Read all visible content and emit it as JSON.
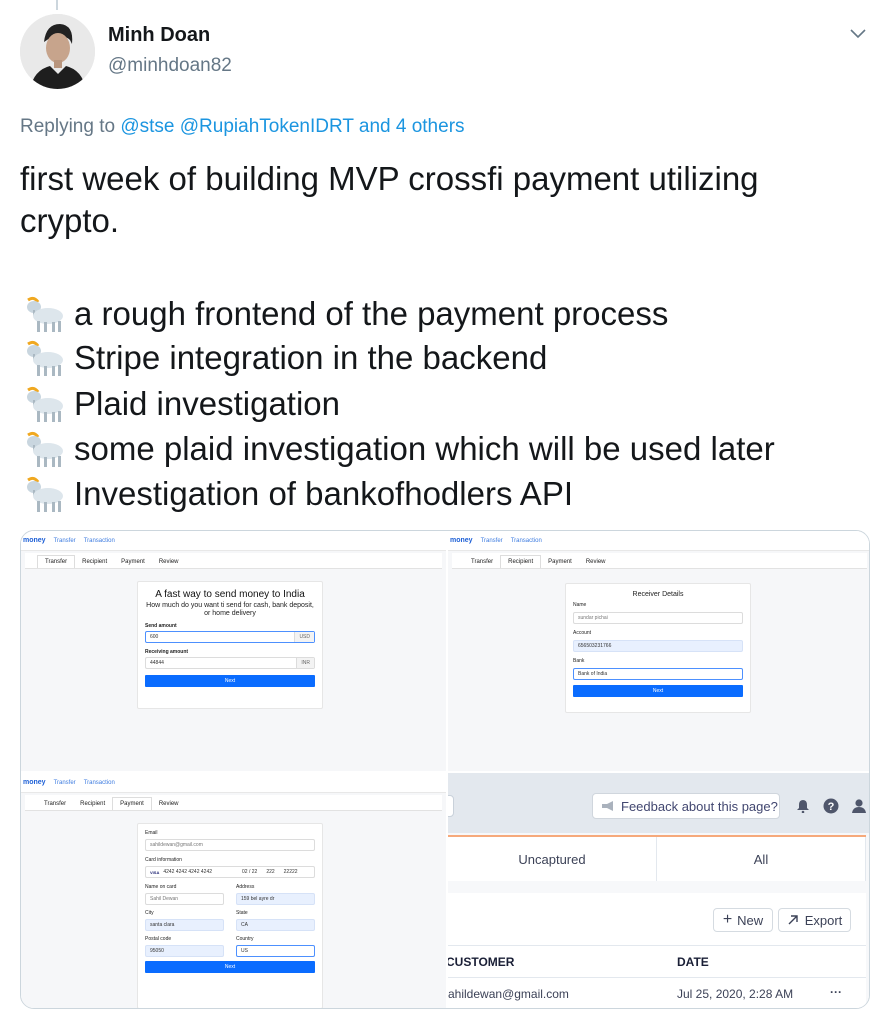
{
  "author": {
    "name": "Minh Doan",
    "handle": "@minhdoan82"
  },
  "reply": {
    "prefix": "Replying to",
    "mention1": "@stse",
    "mention2": "@RupiahTokenIDRT",
    "others": "and 4 others"
  },
  "tweet": {
    "text": "first week of building MVP crossfi payment utilizing crypto.",
    "bullets": [
      "a rough frontend of the payment process",
      "Stripe integration in the backend",
      "Plaid  investigation",
      "some plaid investigation which will be used later",
      "Investigation of bankofhodlers API"
    ]
  },
  "app": {
    "brand": "money",
    "nav_transfer": "Transfer",
    "nav_transaction": "Transaction",
    "tabs": [
      "Transfer",
      "Recipient",
      "Payment",
      "Review"
    ]
  },
  "transfer": {
    "title": "A fast way to send money to India",
    "subtitle": "How much do you want ti send for cash, bank deposit, or home delivery",
    "send_label": "Send amount",
    "send_value": "600",
    "send_currency": "USD",
    "receive_label": "Receiving amount",
    "receive_value": "44844",
    "receive_currency": "INR",
    "next": "Next"
  },
  "recipient": {
    "title": "Receiver Details",
    "name_label": "Name",
    "name_value": "sundar pichai",
    "account_label": "Account",
    "account_value": "656503231766",
    "bank_label": "Bank",
    "bank_value": "Bank of India",
    "next": "Next"
  },
  "payment": {
    "email_label": "Email",
    "email_value": "sahildewan@gmail.com",
    "card_label": "Card information",
    "card_brand": "VISA",
    "card_number": "4242 4242 4242 4242",
    "card_exp": "02 / 22",
    "card_cvc": "222",
    "card_zip": "22222",
    "name_label": "Name on card",
    "name_value": "Sahil Dewan",
    "address_label": "Address",
    "address_value": "159 bel ayre dr",
    "city_label": "City",
    "city_value": "santa clara",
    "state_label": "State",
    "state_value": "CA",
    "postal_label": "Postal code",
    "postal_value": "95050",
    "country_label": "Country",
    "country_value": "US",
    "next": "Next"
  },
  "dashboard": {
    "feedback": "Feedback about this page?",
    "tab_uncaptured": "Uncaptured",
    "tab_all": "All",
    "new_button": "New",
    "export_button": "Export",
    "col_customer": "CUSTOMER",
    "col_date": "DATE",
    "row_customer": "ahildewan@gmail.com",
    "row_date": "Jul 25, 2020, 2:28 AM",
    "row_more": "···"
  }
}
